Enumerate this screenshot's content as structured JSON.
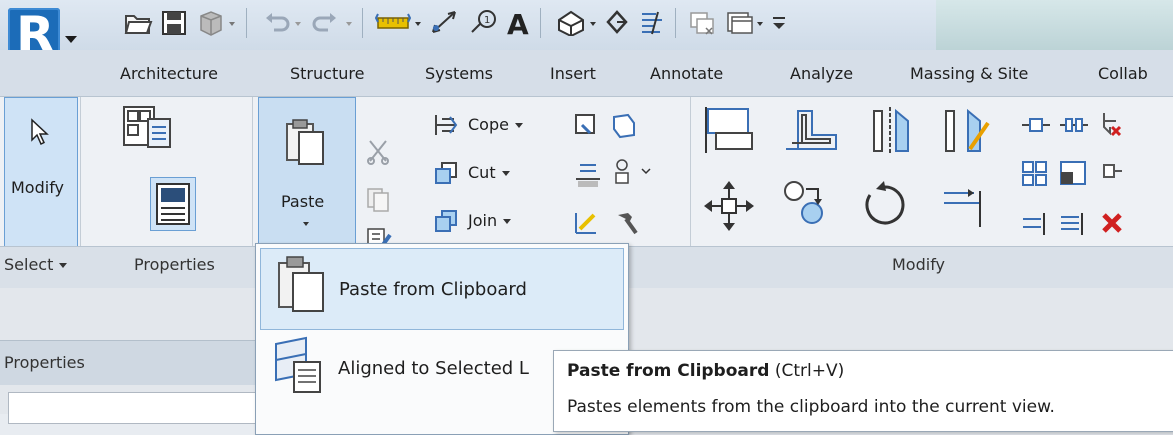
{
  "app": {
    "logo_letter": "R"
  },
  "tabs": [
    "Architecture",
    "Structure",
    "Systems",
    "Insert",
    "Annotate",
    "Analyze",
    "Massing & Site",
    "Collab"
  ],
  "ribbon": {
    "modify_label": "Modify",
    "paste_label": "Paste",
    "cope_label": "Cope",
    "cut_label": "Cut",
    "join_label": "Join"
  },
  "panel_titles": {
    "select": "Select",
    "properties": "Properties",
    "modify": "Modify"
  },
  "dropdown": {
    "item1": "Paste from Clipboard",
    "item2": "Aligned to Selected L"
  },
  "properties_palette": {
    "title": "Properties"
  },
  "tooltip": {
    "title_bold": "Paste from Clipboard",
    "shortcut": "(Ctrl+V)",
    "description": "Pastes elements from the clipboard into the current view."
  },
  "colors": {
    "revit_blue": "#1c6cb8",
    "highlight_blue": "#cfe3f6",
    "delete_red": "#d02020"
  }
}
